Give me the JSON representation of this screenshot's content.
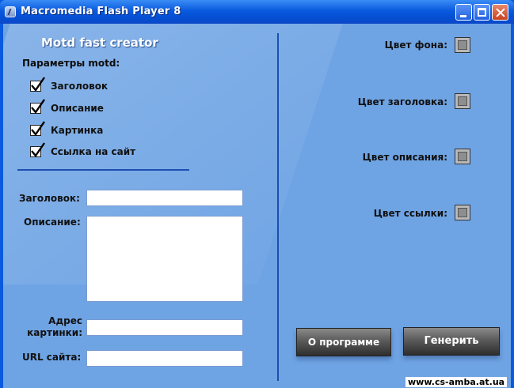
{
  "window": {
    "title": "Macromedia Flash Player 8"
  },
  "app": {
    "title": "Motd fast creator",
    "params_label": "Параметры motd:",
    "checkboxes": [
      {
        "label": "Заголовок",
        "checked": true
      },
      {
        "label": "Описание",
        "checked": true
      },
      {
        "label": "Картинка",
        "checked": true
      },
      {
        "label": "Ссылка на сайт",
        "checked": true
      }
    ],
    "fields": {
      "title_label": "Заголовок:",
      "title_value": "",
      "description_label": "Описание:",
      "description_value": "",
      "image_label_line1": "Адрес",
      "image_label_line2": "картинки:",
      "image_value": "",
      "url_label": "URL сайта:",
      "url_value": ""
    },
    "colors": [
      {
        "label": "Цвет фона:",
        "value": "#8e8e8e"
      },
      {
        "label": "Цвет заголовка:",
        "value": "#8e8e8e"
      },
      {
        "label": "Цвет описания:",
        "value": "#8e8e8e"
      },
      {
        "label": "Цвет ссылки:",
        "value": "#8e8e8e"
      }
    ],
    "buttons": {
      "about": "О программе",
      "generate": "Генерить"
    }
  },
  "watermark": "www.cs-amba.at.ua",
  "theme": {
    "background": "#6fa4e4",
    "titlebar": "#0a5adf",
    "divider": "#1c4faf"
  }
}
